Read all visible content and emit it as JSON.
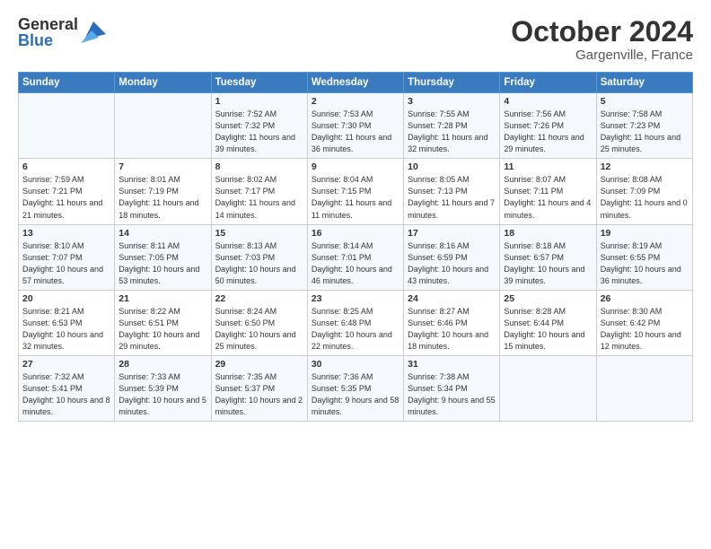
{
  "logo": {
    "general": "General",
    "blue": "Blue"
  },
  "title": "October 2024",
  "location": "Gargenville, France",
  "days_header": [
    "Sunday",
    "Monday",
    "Tuesday",
    "Wednesday",
    "Thursday",
    "Friday",
    "Saturday"
  ],
  "weeks": [
    [
      {
        "day": "",
        "sunrise": "",
        "sunset": "",
        "daylight": ""
      },
      {
        "day": "",
        "sunrise": "",
        "sunset": "",
        "daylight": ""
      },
      {
        "day": "1",
        "sunrise": "Sunrise: 7:52 AM",
        "sunset": "Sunset: 7:32 PM",
        "daylight": "Daylight: 11 hours and 39 minutes."
      },
      {
        "day": "2",
        "sunrise": "Sunrise: 7:53 AM",
        "sunset": "Sunset: 7:30 PM",
        "daylight": "Daylight: 11 hours and 36 minutes."
      },
      {
        "day": "3",
        "sunrise": "Sunrise: 7:55 AM",
        "sunset": "Sunset: 7:28 PM",
        "daylight": "Daylight: 11 hours and 32 minutes."
      },
      {
        "day": "4",
        "sunrise": "Sunrise: 7:56 AM",
        "sunset": "Sunset: 7:26 PM",
        "daylight": "Daylight: 11 hours and 29 minutes."
      },
      {
        "day": "5",
        "sunrise": "Sunrise: 7:58 AM",
        "sunset": "Sunset: 7:23 PM",
        "daylight": "Daylight: 11 hours and 25 minutes."
      }
    ],
    [
      {
        "day": "6",
        "sunrise": "Sunrise: 7:59 AM",
        "sunset": "Sunset: 7:21 PM",
        "daylight": "Daylight: 11 hours and 21 minutes."
      },
      {
        "day": "7",
        "sunrise": "Sunrise: 8:01 AM",
        "sunset": "Sunset: 7:19 PM",
        "daylight": "Daylight: 11 hours and 18 minutes."
      },
      {
        "day": "8",
        "sunrise": "Sunrise: 8:02 AM",
        "sunset": "Sunset: 7:17 PM",
        "daylight": "Daylight: 11 hours and 14 minutes."
      },
      {
        "day": "9",
        "sunrise": "Sunrise: 8:04 AM",
        "sunset": "Sunset: 7:15 PM",
        "daylight": "Daylight: 11 hours and 11 minutes."
      },
      {
        "day": "10",
        "sunrise": "Sunrise: 8:05 AM",
        "sunset": "Sunset: 7:13 PM",
        "daylight": "Daylight: 11 hours and 7 minutes."
      },
      {
        "day": "11",
        "sunrise": "Sunrise: 8:07 AM",
        "sunset": "Sunset: 7:11 PM",
        "daylight": "Daylight: 11 hours and 4 minutes."
      },
      {
        "day": "12",
        "sunrise": "Sunrise: 8:08 AM",
        "sunset": "Sunset: 7:09 PM",
        "daylight": "Daylight: 11 hours and 0 minutes."
      }
    ],
    [
      {
        "day": "13",
        "sunrise": "Sunrise: 8:10 AM",
        "sunset": "Sunset: 7:07 PM",
        "daylight": "Daylight: 10 hours and 57 minutes."
      },
      {
        "day": "14",
        "sunrise": "Sunrise: 8:11 AM",
        "sunset": "Sunset: 7:05 PM",
        "daylight": "Daylight: 10 hours and 53 minutes."
      },
      {
        "day": "15",
        "sunrise": "Sunrise: 8:13 AM",
        "sunset": "Sunset: 7:03 PM",
        "daylight": "Daylight: 10 hours and 50 minutes."
      },
      {
        "day": "16",
        "sunrise": "Sunrise: 8:14 AM",
        "sunset": "Sunset: 7:01 PM",
        "daylight": "Daylight: 10 hours and 46 minutes."
      },
      {
        "day": "17",
        "sunrise": "Sunrise: 8:16 AM",
        "sunset": "Sunset: 6:59 PM",
        "daylight": "Daylight: 10 hours and 43 minutes."
      },
      {
        "day": "18",
        "sunrise": "Sunrise: 8:18 AM",
        "sunset": "Sunset: 6:57 PM",
        "daylight": "Daylight: 10 hours and 39 minutes."
      },
      {
        "day": "19",
        "sunrise": "Sunrise: 8:19 AM",
        "sunset": "Sunset: 6:55 PM",
        "daylight": "Daylight: 10 hours and 36 minutes."
      }
    ],
    [
      {
        "day": "20",
        "sunrise": "Sunrise: 8:21 AM",
        "sunset": "Sunset: 6:53 PM",
        "daylight": "Daylight: 10 hours and 32 minutes."
      },
      {
        "day": "21",
        "sunrise": "Sunrise: 8:22 AM",
        "sunset": "Sunset: 6:51 PM",
        "daylight": "Daylight: 10 hours and 29 minutes."
      },
      {
        "day": "22",
        "sunrise": "Sunrise: 8:24 AM",
        "sunset": "Sunset: 6:50 PM",
        "daylight": "Daylight: 10 hours and 25 minutes."
      },
      {
        "day": "23",
        "sunrise": "Sunrise: 8:25 AM",
        "sunset": "Sunset: 6:48 PM",
        "daylight": "Daylight: 10 hours and 22 minutes."
      },
      {
        "day": "24",
        "sunrise": "Sunrise: 8:27 AM",
        "sunset": "Sunset: 6:46 PM",
        "daylight": "Daylight: 10 hours and 18 minutes."
      },
      {
        "day": "25",
        "sunrise": "Sunrise: 8:28 AM",
        "sunset": "Sunset: 6:44 PM",
        "daylight": "Daylight: 10 hours and 15 minutes."
      },
      {
        "day": "26",
        "sunrise": "Sunrise: 8:30 AM",
        "sunset": "Sunset: 6:42 PM",
        "daylight": "Daylight: 10 hours and 12 minutes."
      }
    ],
    [
      {
        "day": "27",
        "sunrise": "Sunrise: 7:32 AM",
        "sunset": "Sunset: 5:41 PM",
        "daylight": "Daylight: 10 hours and 8 minutes."
      },
      {
        "day": "28",
        "sunrise": "Sunrise: 7:33 AM",
        "sunset": "Sunset: 5:39 PM",
        "daylight": "Daylight: 10 hours and 5 minutes."
      },
      {
        "day": "29",
        "sunrise": "Sunrise: 7:35 AM",
        "sunset": "Sunset: 5:37 PM",
        "daylight": "Daylight: 10 hours and 2 minutes."
      },
      {
        "day": "30",
        "sunrise": "Sunrise: 7:36 AM",
        "sunset": "Sunset: 5:35 PM",
        "daylight": "Daylight: 9 hours and 58 minutes."
      },
      {
        "day": "31",
        "sunrise": "Sunrise: 7:38 AM",
        "sunset": "Sunset: 5:34 PM",
        "daylight": "Daylight: 9 hours and 55 minutes."
      },
      {
        "day": "",
        "sunrise": "",
        "sunset": "",
        "daylight": ""
      },
      {
        "day": "",
        "sunrise": "",
        "sunset": "",
        "daylight": ""
      }
    ]
  ]
}
